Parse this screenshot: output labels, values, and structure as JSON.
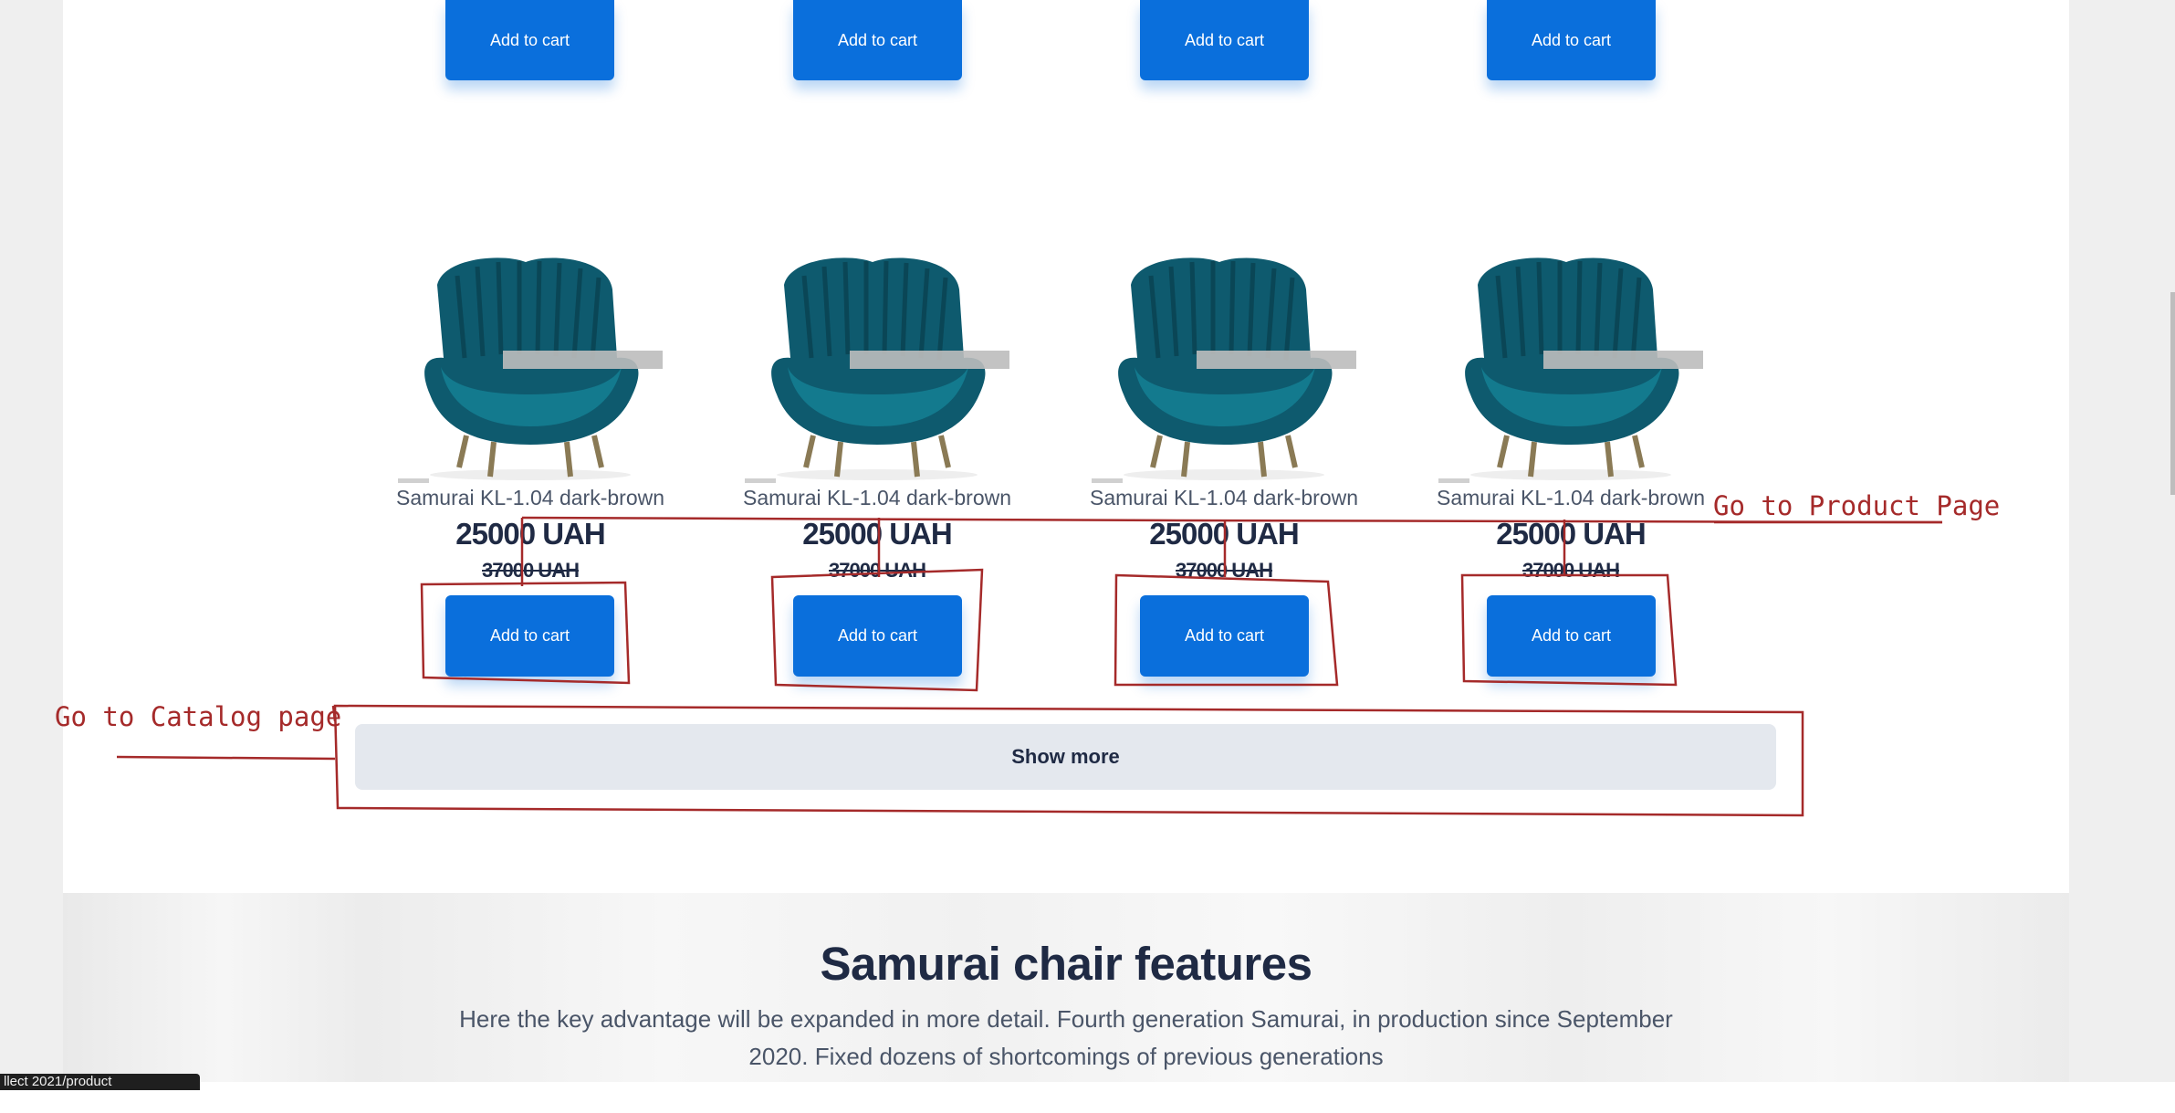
{
  "top_row": {
    "add_to_cart_label": "Add to cart"
  },
  "products": [
    {
      "name": "Samurai KL-1.04 dark-brown",
      "price": "25000 UAH",
      "old_price": "37000 UAH",
      "add_to_cart_label": "Add to cart"
    },
    {
      "name": "Samurai KL-1.04 dark-brown",
      "price": "25000 UAH",
      "old_price": "37000 UAH",
      "add_to_cart_label": "Add to cart"
    },
    {
      "name": "Samurai KL-1.04 dark-brown",
      "price": "25000 UAH",
      "old_price": "37000 UAH",
      "add_to_cart_label": "Add to cart"
    },
    {
      "name": "Samurai KL-1.04 dark-brown",
      "price": "25000 UAH",
      "old_price": "37000 UAH",
      "add_to_cart_label": "Add to cart"
    }
  ],
  "show_more_label": "Show more",
  "features": {
    "title": "Samurai chair features",
    "description": "Here the key advantage will be expanded in more detail. Fourth generation Samurai, in production since September 2020. Fixed dozens of shortcomings of previous generations"
  },
  "annotations": {
    "product_page": "Go to Product Page",
    "catalog_page": "Go to Catalog page"
  },
  "status_bar_text": "llect 2021/product",
  "colors": {
    "primary_button": "#0a6fdc",
    "annotation": "#a52a2a",
    "heading": "#1f2a44"
  }
}
